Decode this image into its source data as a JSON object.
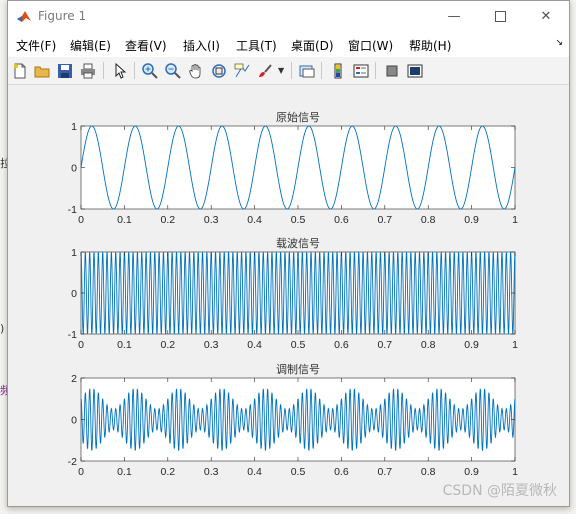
{
  "window": {
    "title": "Figure 1"
  },
  "menu": [
    "文件(F)",
    "编辑(E)",
    "查看(V)",
    "插入(I)",
    "工具(T)",
    "桌面(D)",
    "窗口(W)",
    "帮助(H)"
  ],
  "toolbar_icons": [
    "new-figure-icon",
    "open-file-icon",
    "save-icon",
    "print-icon",
    "pointer-icon",
    "zoom-in-icon",
    "zoom-out-icon",
    "pan-hand-icon",
    "rotate-3d-icon",
    "data-cursor-icon",
    "brush-icon",
    "link-plot-icon",
    "colorbar-icon",
    "legend-icon",
    "hide-plot-tools-icon",
    "show-plot-tools-icon"
  ],
  "background_glyphs": [
    "拉",
    ")",
    "频"
  ],
  "watermark": "CSDN @陌夏微秋",
  "chart_data": [
    {
      "type": "line",
      "title": "原始信号",
      "function": "sin(2*pi*10*t)",
      "x_range": [
        0,
        1
      ],
      "ylim": [
        -1,
        1
      ],
      "xticks": [
        "0",
        "0.1",
        "0.2",
        "0.3",
        "0.4",
        "0.5",
        "0.6",
        "0.7",
        "0.8",
        "0.9",
        "1"
      ],
      "yticks": [
        "1",
        "0",
        "-1"
      ],
      "series_color": "#0072bd"
    },
    {
      "type": "line",
      "title": "载波信号",
      "function": "cos(2*pi*100*t)",
      "x_range": [
        0,
        1
      ],
      "ylim": [
        -1,
        1
      ],
      "xticks": [
        "0",
        "0.1",
        "0.2",
        "0.3",
        "0.4",
        "0.5",
        "0.6",
        "0.7",
        "0.8",
        "0.9",
        "1"
      ],
      "yticks": [
        "1",
        "0",
        "-1"
      ],
      "series_color": "#0072bd"
    },
    {
      "type": "line",
      "title": "调制信号",
      "function": "(1+0.5*sin(2*pi*10*t))*cos(2*pi*100*t)",
      "x_range": [
        0,
        1
      ],
      "ylim": [
        -2,
        2
      ],
      "xticks": [
        "0",
        "0.1",
        "0.2",
        "0.3",
        "0.4",
        "0.5",
        "0.6",
        "0.7",
        "0.8",
        "0.9",
        "1"
      ],
      "yticks": [
        "2",
        "0",
        "-2"
      ],
      "series_color": "#0072bd"
    }
  ]
}
